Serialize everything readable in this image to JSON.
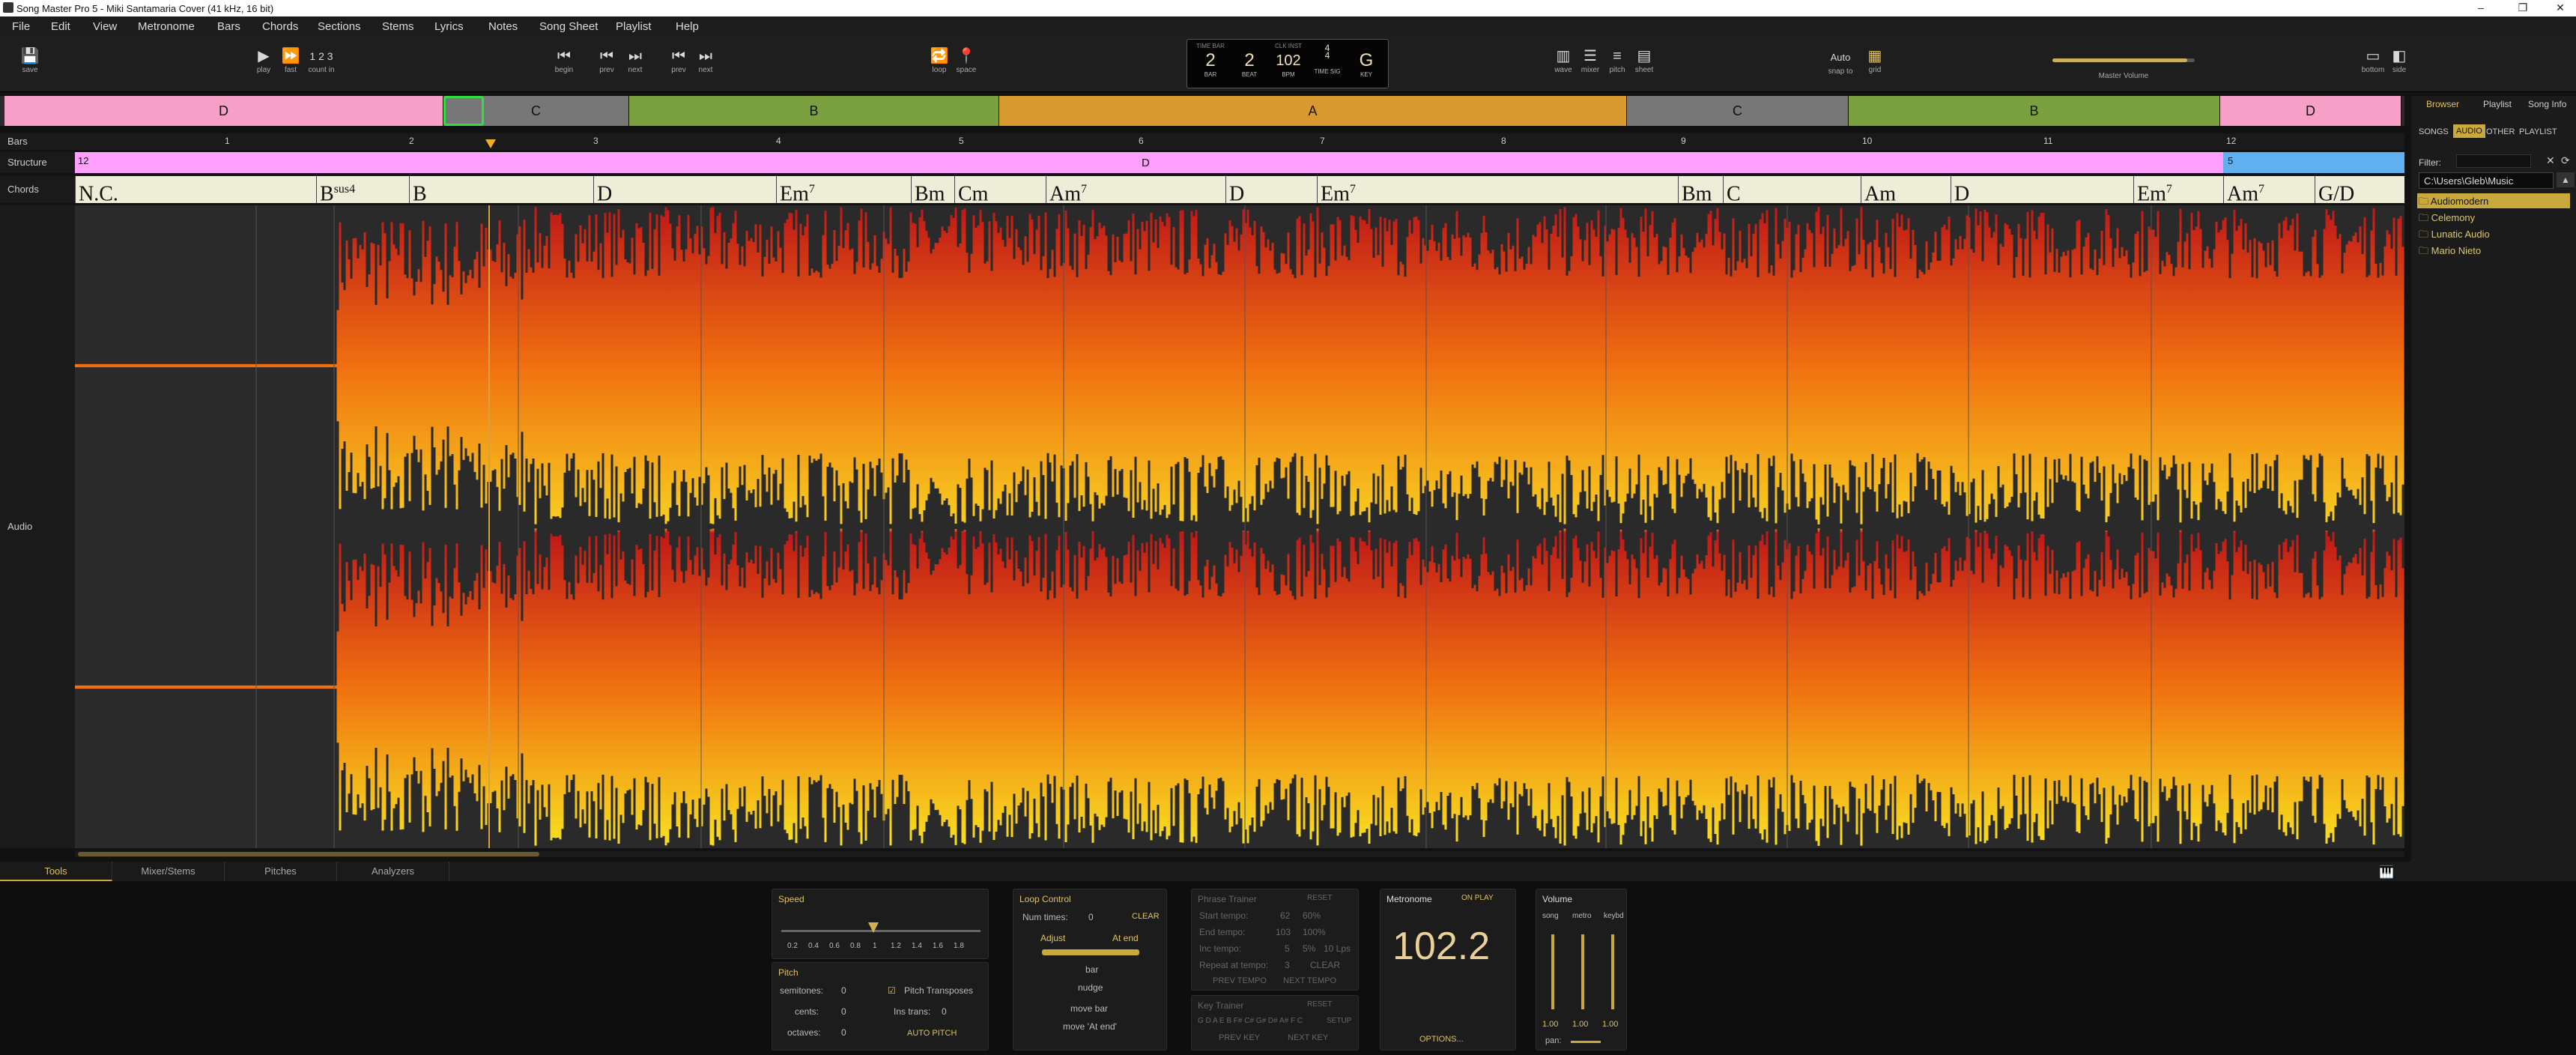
{
  "window": {
    "title": "Song Master Pro 5 - Miki Santamaria Cover (41 kHz, 16 bit)"
  },
  "menu": [
    "File",
    "Edit",
    "View",
    "Metronome",
    "Bars",
    "Chords",
    "Sections",
    "Stems",
    "Lyrics",
    "Notes",
    "Song Sheet",
    "Playlist",
    "Help"
  ],
  "toolbar": {
    "save": "save",
    "play": "play",
    "fast": "fast",
    "count_in": "count in",
    "begin": "begin",
    "prev": "prev",
    "next": "next",
    "prev2": "prev",
    "next2": "next",
    "loop": "loop",
    "space": "space",
    "wave": "wave",
    "mixer": "mixer",
    "pitch": "pitch",
    "sheet": "sheet",
    "snap_value": "Auto",
    "snap": "snap to",
    "grid": "grid",
    "master_volume": "Master Volume",
    "bottom": "bottom",
    "side": "side",
    "count_glyph": "1 2 3"
  },
  "lcd": {
    "bar_head": "TIME BAR",
    "bar": "2",
    "bar_label": "BAR",
    "beat": "2",
    "beat_label": "BEAT",
    "bpm_head": "CLK INST",
    "bpm": "102",
    "bpm_label": "BPM",
    "ts_top": "4",
    "ts_bottom": "4",
    "ts_label": "TIME SIG",
    "key": "G",
    "key_label": "KEY"
  },
  "overview": {
    "sections": [
      {
        "label": "D",
        "color": "#f6a0c8"
      },
      {
        "label": "C",
        "color": "#777777"
      },
      {
        "label": "B",
        "color": "#7aa040"
      },
      {
        "label": "A",
        "color": "#d89a30"
      },
      {
        "label": "C",
        "color": "#777777"
      },
      {
        "label": "B",
        "color": "#7aa040"
      },
      {
        "label": "D",
        "color": "#f6a0c8"
      }
    ]
  },
  "lanes": {
    "bars": "Bars",
    "structure": "Structure",
    "chords": "Chords",
    "audio": "Audio"
  },
  "ruler": [
    "1",
    "2",
    "3",
    "4",
    "5",
    "6",
    "7",
    "8",
    "9",
    "10",
    "11",
    "12"
  ],
  "structure": {
    "start": "12",
    "label": "D",
    "right": "5"
  },
  "chords": [
    {
      "name": "N.C.",
      "sup": ""
    },
    {
      "name": "B",
      "sup": "sus4"
    },
    {
      "name": "B",
      "sup": ""
    },
    {
      "name": "D",
      "sup": ""
    },
    {
      "name": "Em",
      "sup": "7"
    },
    {
      "name": "Bm",
      "sup": ""
    },
    {
      "name": "Cm",
      "sup": ""
    },
    {
      "name": "Am",
      "sup": "7"
    },
    {
      "name": "D",
      "sup": ""
    },
    {
      "name": "Em",
      "sup": "7"
    },
    {
      "name": "Bm",
      "sup": ""
    },
    {
      "name": "C",
      "sup": ""
    },
    {
      "name": "Am",
      "sup": ""
    },
    {
      "name": "D",
      "sup": ""
    },
    {
      "name": "Em",
      "sup": "7"
    },
    {
      "name": "Am",
      "sup": "7"
    },
    {
      "name": "G/D",
      "sup": ""
    }
  ],
  "sidebar": {
    "tabs": [
      "Browser",
      "Playlist",
      "Song Info"
    ],
    "sub": [
      "SONGS",
      "AUDIO",
      "OTHER",
      "PLAYLIST"
    ],
    "path": "C:\\Users\\Gleb\\Music",
    "filter": "Filter:",
    "folders": [
      "Audiomodern",
      "Celemony",
      "Lunatic Audio",
      "Mario Nieto"
    ]
  },
  "bottom_tabs": [
    "Tools",
    "Mixer/Stems",
    "Pitches",
    "Analyzers"
  ],
  "speed": {
    "title": "Speed",
    "ticks": [
      "0.2",
      "0.4",
      "0.6",
      "0.8",
      "1",
      "1.2",
      "1.4",
      "1.6",
      "1.8"
    ]
  },
  "pitch": {
    "title": "Pitch",
    "semitones": "semitones:",
    "semi_v": "0",
    "cents": "cents:",
    "cents_v": "0",
    "octaves": "octaves:",
    "oct_v": "0",
    "transposes": "Pitch Transposes",
    "ins": "Ins trans:",
    "ins_v": "0",
    "auto": "AUTO PITCH"
  },
  "loop": {
    "title": "Loop Control",
    "num": "Num times:",
    "num_v": "0",
    "clear": "CLEAR",
    "adjust": "Adjust",
    "atend": "At end",
    "bar": "bar",
    "nudge": "nudge",
    "movebar": "move bar",
    "moveend": "move 'At end'"
  },
  "phrase": {
    "title": "Phrase Trainer",
    "reset": "RESET",
    "start": "Start tempo:",
    "start_v": "62",
    "start_p": "60%",
    "end": "End tempo:",
    "end_v": "103",
    "end_p": "100%",
    "inc": "Inc tempo:",
    "inc_v": "5",
    "inc_p": "5%",
    "inc_l": "10 Lps",
    "rep": "Repeat at tempo:",
    "rep_v": "3",
    "rep_c": "CLEAR",
    "prev": "PREV TEMPO",
    "next": "NEXT TEMPO"
  },
  "key": {
    "title": "Key Trainer",
    "reset": "RESET",
    "notes": "G D A E B F# C# G# D# A# F C",
    "setup": "SETUP",
    "prev": "PREV KEY",
    "next": "NEXT KEY"
  },
  "metronome": {
    "title": "Metronome",
    "onplay": "ON PLAY",
    "value": "102.2",
    "options": "OPTIONS..."
  },
  "volume": {
    "title": "Volume",
    "cols": [
      "song",
      "metro",
      "keybd"
    ],
    "vals": [
      "1.00",
      "1.00",
      "1.00"
    ],
    "pan": "pan:"
  }
}
